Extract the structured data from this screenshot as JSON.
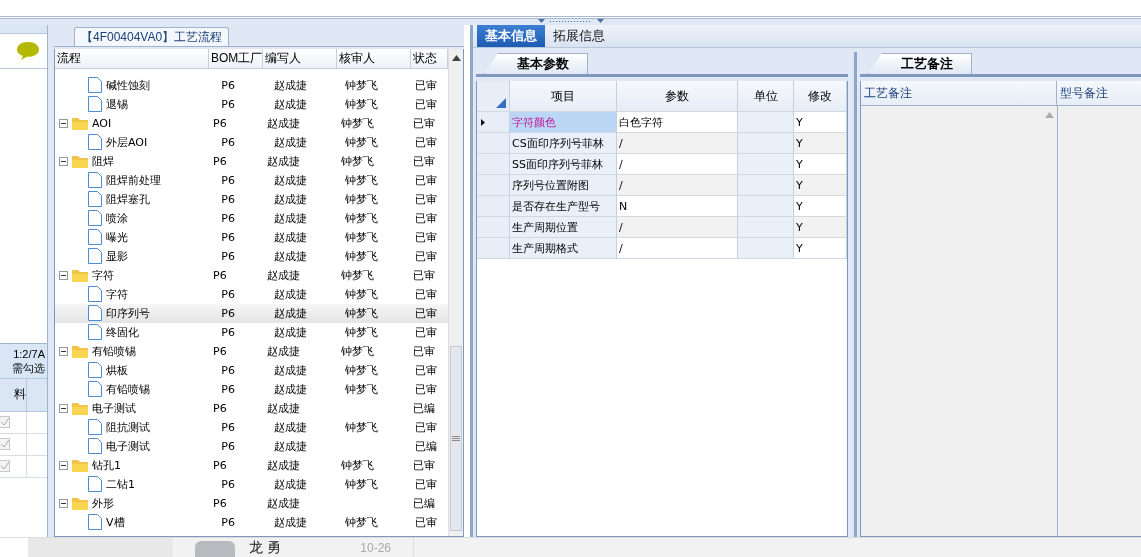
{
  "side": {
    "info": "1:2/7A",
    "hint": "需勾选",
    "column": "料",
    "rows": [
      {
        "checked": true
      },
      {
        "checked": true
      },
      {
        "checked": true
      }
    ]
  },
  "flow": {
    "title": "【4F00404VA0】工艺流程",
    "columns": [
      "流程",
      "BOM工厂",
      "编写人",
      "核审人",
      "状态"
    ],
    "tree": [
      {
        "kind": "hidden",
        "children": [
          {
            "kind": "file",
            "label": "碱性蚀刻",
            "factory": "P6",
            "writer": "赵成捷",
            "reviewer": "钟梦飞",
            "status": "已审",
            "selected": false
          },
          {
            "kind": "file",
            "label": "退锡",
            "factory": "P6",
            "writer": "赵成捷",
            "reviewer": "钟梦飞",
            "status": "已审",
            "selected": false
          }
        ]
      },
      {
        "kind": "folder",
        "label": "AOI",
        "factory": "P6",
        "writer": "赵成捷",
        "reviewer": "钟梦飞",
        "status": "已审",
        "selected": false,
        "expanded": true,
        "children": [
          {
            "kind": "file",
            "label": "外层AOI",
            "factory": "P6",
            "writer": "赵成捷",
            "reviewer": "钟梦飞",
            "status": "已审",
            "selected": false
          }
        ]
      },
      {
        "kind": "folder",
        "label": "阻焊",
        "factory": "P6",
        "writer": "赵成捷",
        "reviewer": "钟梦飞",
        "status": "已审",
        "selected": false,
        "expanded": true,
        "children": [
          {
            "kind": "file",
            "label": "阻焊前处理",
            "factory": "P6",
            "writer": "赵成捷",
            "reviewer": "钟梦飞",
            "status": "已审",
            "selected": false
          },
          {
            "kind": "file",
            "label": "阻焊塞孔",
            "factory": "P6",
            "writer": "赵成捷",
            "reviewer": "钟梦飞",
            "status": "已审",
            "selected": false
          },
          {
            "kind": "file",
            "label": "喷涂",
            "factory": "P6",
            "writer": "赵成捷",
            "reviewer": "钟梦飞",
            "status": "已审",
            "selected": false
          },
          {
            "kind": "file",
            "label": "曝光",
            "factory": "P6",
            "writer": "赵成捷",
            "reviewer": "钟梦飞",
            "status": "已审",
            "selected": false
          },
          {
            "kind": "file",
            "label": "显影",
            "factory": "P6",
            "writer": "赵成捷",
            "reviewer": "钟梦飞",
            "status": "已审",
            "selected": false
          }
        ]
      },
      {
        "kind": "folder",
        "label": "字符",
        "factory": "P6",
        "writer": "赵成捷",
        "reviewer": "钟梦飞",
        "status": "已审",
        "selected": false,
        "expanded": true,
        "children": [
          {
            "kind": "file",
            "label": "字符",
            "factory": "P6",
            "writer": "赵成捷",
            "reviewer": "钟梦飞",
            "status": "已审",
            "selected": false
          },
          {
            "kind": "file",
            "label": "印序列号",
            "factory": "P6",
            "writer": "赵成捷",
            "reviewer": "钟梦飞",
            "status": "已审",
            "selected": true
          },
          {
            "kind": "file",
            "label": "终固化",
            "factory": "P6",
            "writer": "赵成捷",
            "reviewer": "钟梦飞",
            "status": "已审",
            "selected": false
          }
        ]
      },
      {
        "kind": "folder",
        "label": "有铅喷锡",
        "factory": "P6",
        "writer": "赵成捷",
        "reviewer": "钟梦飞",
        "status": "已审",
        "selected": false,
        "expanded": true,
        "children": [
          {
            "kind": "file",
            "label": "烘板",
            "factory": "P6",
            "writer": "赵成捷",
            "reviewer": "钟梦飞",
            "status": "已审",
            "selected": false
          },
          {
            "kind": "file",
            "label": "有铅喷锡",
            "factory": "P6",
            "writer": "赵成捷",
            "reviewer": "钟梦飞",
            "status": "已审",
            "selected": false
          }
        ]
      },
      {
        "kind": "folder",
        "label": "电子测试",
        "factory": "P6",
        "writer": "赵成捷",
        "status": "已编",
        "selected": false,
        "expanded": true,
        "children": [
          {
            "kind": "file",
            "label": "阻抗测试",
            "factory": "P6",
            "writer": "赵成捷",
            "reviewer": "钟梦飞",
            "status": "已审",
            "selected": false
          },
          {
            "kind": "file",
            "label": "电子测试",
            "factory": "P6",
            "writer": "赵成捷",
            "status": "已编",
            "selected": false
          }
        ]
      },
      {
        "kind": "folder",
        "label": "钻孔1",
        "factory": "P6",
        "writer": "赵成捷",
        "reviewer": "钟梦飞",
        "status": "已审",
        "selected": false,
        "expanded": true,
        "children": [
          {
            "kind": "file",
            "label": "二钻1",
            "factory": "P6",
            "writer": "赵成捷",
            "reviewer": "钟梦飞",
            "status": "已审",
            "selected": false
          }
        ]
      },
      {
        "kind": "folder",
        "label": "外形",
        "factory": "P6",
        "writer": "赵成捷",
        "status": "已编",
        "selected": false,
        "expanded": true,
        "children": [
          {
            "kind": "file",
            "label": "V槽",
            "factory": "P6",
            "writer": "赵成捷",
            "reviewer": "钟梦飞",
            "status": "已审",
            "selected": false
          }
        ]
      }
    ]
  },
  "tabs": [
    {
      "label": "基本信息",
      "selected": true
    },
    {
      "label": "拓展信息",
      "selected": false
    }
  ],
  "params": {
    "tab": "基本参数",
    "columns": [
      "项目",
      "参数",
      "单位",
      "修改"
    ],
    "rows": [
      {
        "item": "字符颜色",
        "value": "白色字符",
        "modify": "Y",
        "selected": true
      },
      {
        "item": "CS面印序列号菲林",
        "value": "/",
        "modify": "Y",
        "selected": false
      },
      {
        "item": "SS面印序列号菲林",
        "value": "/",
        "modify": "Y",
        "selected": false
      },
      {
        "item": "序列号位置附图",
        "value": "/",
        "modify": "Y",
        "selected": false
      },
      {
        "item": "是否存在生产型号",
        "value": "N",
        "modify": "Y",
        "selected": false
      },
      {
        "item": "生产周期位置",
        "value": "/",
        "modify": "Y",
        "selected": false
      },
      {
        "item": "生产周期格式",
        "value": "/",
        "modify": "Y",
        "selected": false
      }
    ]
  },
  "notes": {
    "tab": "工艺备注",
    "columns": [
      "工艺备注",
      "型号备注"
    ]
  },
  "status_bar": {
    "user": "龙 勇",
    "date": "10-26"
  }
}
